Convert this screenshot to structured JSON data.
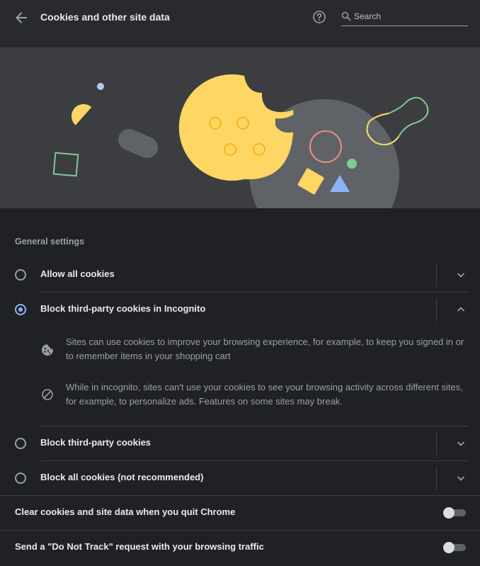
{
  "header": {
    "title": "Cookies and other site data",
    "back_icon": "arrow-back-icon",
    "help_icon": "help-circle-icon",
    "search_icon": "search-icon",
    "search_placeholder": "Search",
    "search_value": ""
  },
  "section": {
    "label": "General settings"
  },
  "options": [
    {
      "label": "Allow all cookies",
      "selected": false,
      "expanded": false
    },
    {
      "label": "Block third-party cookies in Incognito",
      "selected": true,
      "expanded": true
    },
    {
      "label": "Block third-party cookies",
      "selected": false,
      "expanded": false
    },
    {
      "label": "Block all cookies (not recommended)",
      "selected": false,
      "expanded": false
    }
  ],
  "details": [
    {
      "icon": "cookie-icon",
      "text": "Sites can use cookies to improve your browsing experience, for example, to keep you signed in or to remember items in your shopping cart"
    },
    {
      "icon": "block-icon",
      "text": "While in incognito, sites can't use your cookies to see your browsing activity across different sites, for example, to personalize ads. Features on some sites may break."
    }
  ],
  "toggles": [
    {
      "label": "Clear cookies and site data when you quit Chrome",
      "on": false
    },
    {
      "label": "Send a \"Do Not Track\" request with your browsing traffic",
      "on": false
    }
  ],
  "colors": {
    "background": "#202124",
    "header": "#292a2d",
    "banner": "#3c3d40",
    "accent": "#8ab4f8",
    "cookie": "#fdd663"
  }
}
